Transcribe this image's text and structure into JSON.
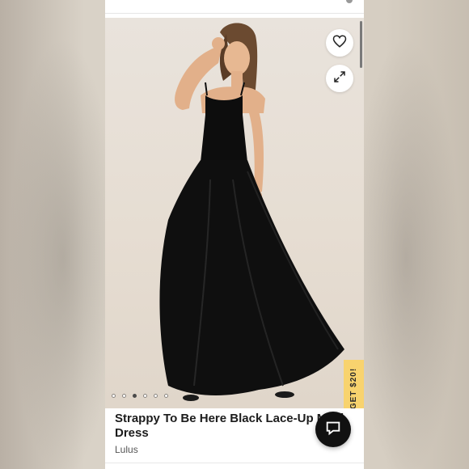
{
  "product": {
    "title": "Strappy To Be Here Black Lace-Up Maxi Dress",
    "brand": "Lulus"
  },
  "promo": {
    "label": "GET $20!"
  },
  "gallery": {
    "dot_count": 6,
    "active_index": 2
  },
  "icons": {
    "favorite": "heart-icon",
    "expand": "expand-icon",
    "chat": "chat-bubble-icon"
  },
  "colors": {
    "promo": "#f8d36e",
    "chat_button": "#111111",
    "dress": "#0d0d0d"
  }
}
